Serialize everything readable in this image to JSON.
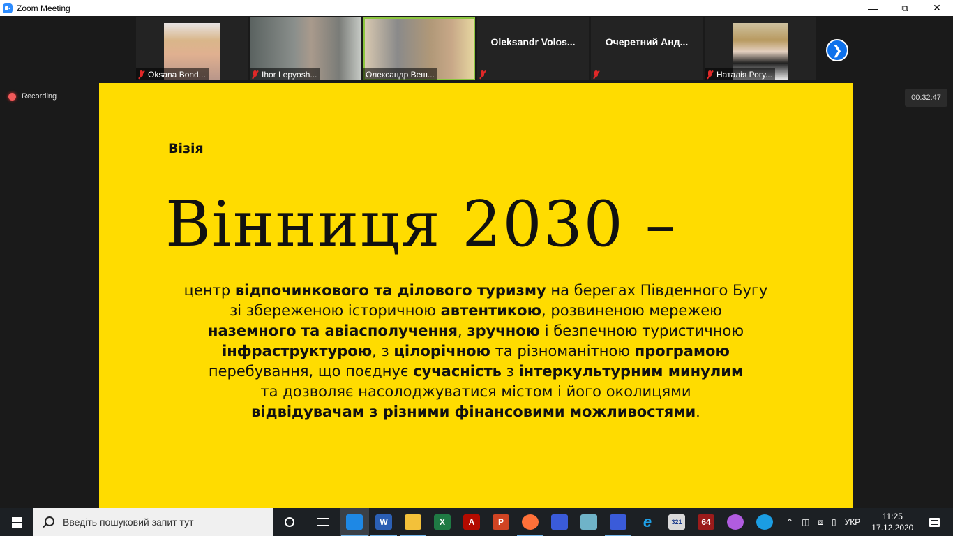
{
  "window": {
    "title": "Zoom Meeting",
    "minimize_icon": "minimize-icon",
    "maximize_icon": "restore-icon",
    "close_icon": "close-icon"
  },
  "participants": [
    {
      "name": "Oksana Bond...",
      "muted": true,
      "video": true
    },
    {
      "name": "Ihor Lepyosh...",
      "muted": true,
      "video": true
    },
    {
      "name": "Олександр Веш...",
      "muted": false,
      "video": true,
      "active_speaker": true
    },
    {
      "name": "Oleksandr  Volos...",
      "muted": true,
      "video": false
    },
    {
      "name": "Очеретний  Анд...",
      "muted": true,
      "video": false
    },
    {
      "name": "Наталія Рогу...",
      "muted": true,
      "video": true
    }
  ],
  "strip_next_icon": "chevron-right-icon",
  "recording": {
    "label": "Recording"
  },
  "timer": "00:32:47",
  "slide": {
    "label": "Візія",
    "title": "Вінниця 2030 –",
    "body_lines": [
      [
        {
          "t": "центр ",
          "b": false
        },
        {
          "t": "відпочинкового та ділового туризму",
          "b": true
        },
        {
          "t": " на берегах Південного Бугу",
          "b": false
        }
      ],
      [
        {
          "t": "зі збереженою історичною ",
          "b": false
        },
        {
          "t": "автентикою",
          "b": true
        },
        {
          "t": ", розвиненою мережею",
          "b": false
        }
      ],
      [
        {
          "t": "наземного та авіасполучення",
          "b": true
        },
        {
          "t": ", ",
          "b": false
        },
        {
          "t": "зручною",
          "b": true
        },
        {
          "t": " і безпечною туристичною",
          "b": false
        }
      ],
      [
        {
          "t": "інфраструктурою",
          "b": true
        },
        {
          "t": ", з ",
          "b": false
        },
        {
          "t": "цілорічною",
          "b": true
        },
        {
          "t": " та різноманітною ",
          "b": false
        },
        {
          "t": "програмою",
          "b": true
        }
      ],
      [
        {
          "t": "перебування, що поєднує ",
          "b": false
        },
        {
          "t": "сучасність",
          "b": true
        },
        {
          "t": " з ",
          "b": false
        },
        {
          "t": "інтеркультурним минулим",
          "b": true
        }
      ],
      [
        {
          "t": "та дозволяє насолоджуватися містом і його околицями",
          "b": false
        }
      ],
      [
        {
          "t": "відвідувачам з різними фінансовими можливостями",
          "b": true
        },
        {
          "t": ".",
          "b": false
        }
      ]
    ]
  },
  "taskbar": {
    "search_placeholder": "Введіть пошуковий запит тут",
    "apps": [
      {
        "name": "zoom-window",
        "label": "",
        "color": "#1e88e5",
        "active": true,
        "running": true
      },
      {
        "name": "word",
        "label": "W",
        "color": "#2b5fb4",
        "running": true
      },
      {
        "name": "file-explorer",
        "label": "",
        "color": "#f3c13a",
        "running": true
      },
      {
        "name": "excel",
        "label": "X",
        "color": "#1f7a44",
        "running": false
      },
      {
        "name": "acrobat",
        "label": "A",
        "color": "#b30b00",
        "running": false
      },
      {
        "name": "powerpoint",
        "label": "P",
        "color": "#d04423",
        "running": false
      },
      {
        "name": "firefox",
        "label": "",
        "color": "#ff7139",
        "running": true
      },
      {
        "name": "floppy-app",
        "label": "",
        "color": "#3a5bd9",
        "running": false
      },
      {
        "name": "notepad-app",
        "label": "",
        "color": "#6fb3c8",
        "running": false
      },
      {
        "name": "floppy-app-2",
        "label": "",
        "color": "#3a5bd9",
        "running": true
      },
      {
        "name": "internet-explorer",
        "label": "e",
        "color": "#1ea1e9",
        "running": false
      },
      {
        "name": "media-player-classic",
        "label": "321",
        "color": "#d9d9d9",
        "running": false
      },
      {
        "name": "puzzle-64-app",
        "label": "64",
        "color": "#9b1b1b",
        "running": false
      },
      {
        "name": "paint-drop-app",
        "label": "",
        "color": "#b15ce0",
        "running": false
      },
      {
        "name": "edge",
        "label": "",
        "color": "#1b9de2",
        "running": false
      }
    ],
    "language": "УКР",
    "time": "11:25",
    "date": "17.12.2020"
  }
}
